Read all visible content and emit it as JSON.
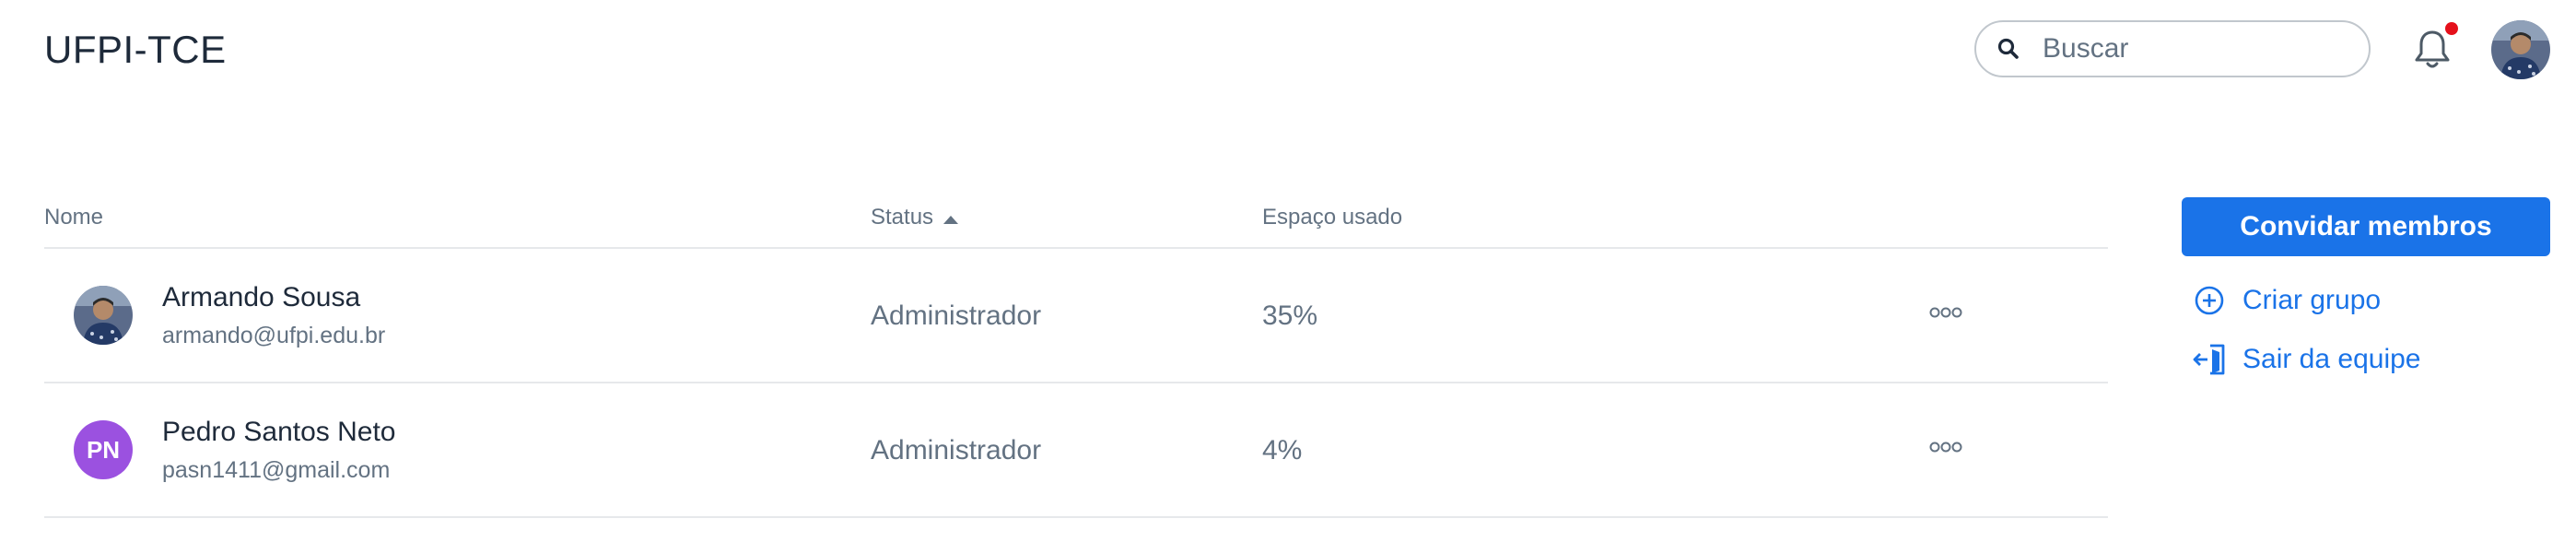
{
  "header": {
    "title": "UFPI-TCE",
    "search": {
      "placeholder": "Buscar",
      "value": ""
    },
    "notification_icon": "bell-icon",
    "has_unread": true,
    "avatar_icon": "user-avatar-photo"
  },
  "table": {
    "columns": {
      "name": "Nome",
      "status": "Status",
      "space": "Espaço usado"
    },
    "sort": {
      "column": "Status",
      "direction": "ascending"
    },
    "rows": [
      {
        "name": "Armando Sousa",
        "email": "armando@ufpi.edu.br",
        "status": "Administrador",
        "space": "35%",
        "avatar": {
          "type": "photo"
        }
      },
      {
        "name": "Pedro Santos Neto",
        "email": "pasn1411@gmail.com",
        "status": "Administrador",
        "space": "4%",
        "avatar": {
          "type": "initials",
          "initials": "PN",
          "color": "#9b51e0"
        }
      }
    ],
    "row_action_icon": "more-horizontal-icon"
  },
  "actions": {
    "invite_label": "Convidar membros",
    "create_group_label": "Criar grupo",
    "leave_team_label": "Sair da equipe"
  },
  "colors": {
    "accent": "#1a73e8",
    "notification_dot": "#e5101b",
    "text_primary": "#1e2a3a",
    "text_secondary": "#637282"
  }
}
